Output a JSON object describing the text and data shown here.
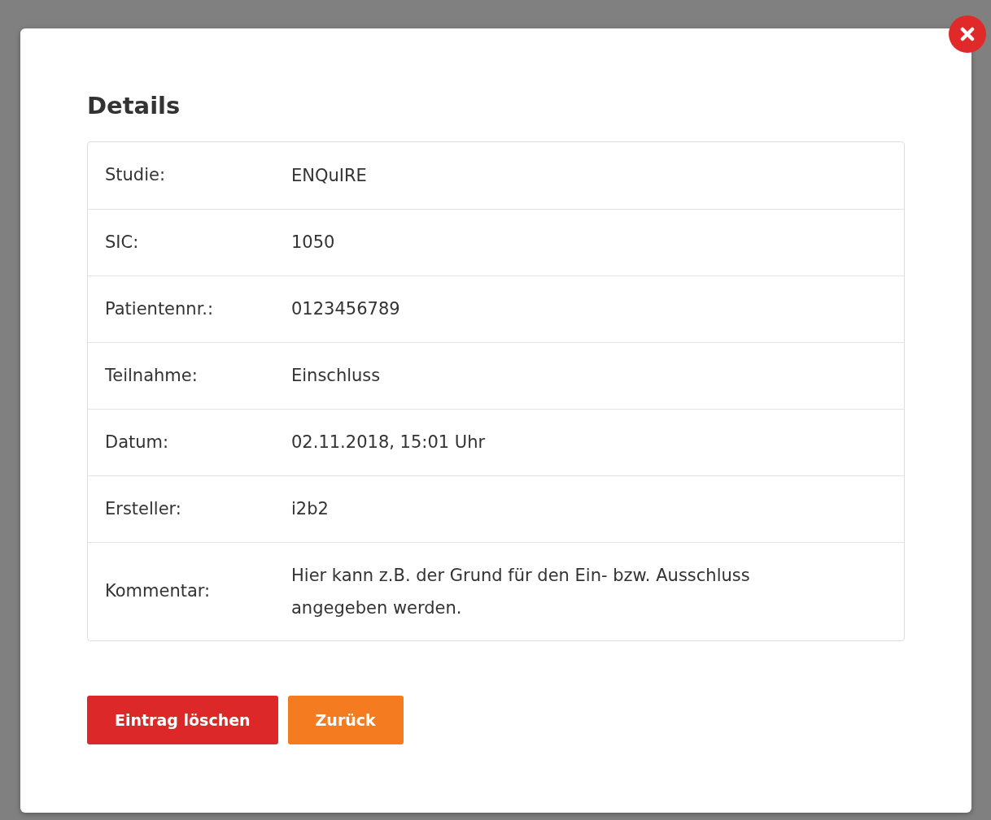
{
  "dialog": {
    "title": "Details",
    "rows": [
      {
        "label": "Studie:",
        "value": "ENQuIRE"
      },
      {
        "label": "SIC:",
        "value": "1050"
      },
      {
        "label": "Patientennr.:",
        "value": "0123456789"
      },
      {
        "label": "Teilnahme:",
        "value": "Einschluss"
      },
      {
        "label": "Datum:",
        "value": "02.11.2018, 15:01 Uhr"
      },
      {
        "label": "Ersteller:",
        "value": "i2b2"
      },
      {
        "label": "Kommentar:",
        "value": "Hier kann z.B. der Grund für den Ein- bzw. Ausschluss angegeben werden."
      }
    ],
    "buttons": [
      {
        "label": "Eintrag löschen",
        "kind": "danger"
      },
      {
        "label": "Zurück",
        "kind": "warning"
      }
    ]
  }
}
